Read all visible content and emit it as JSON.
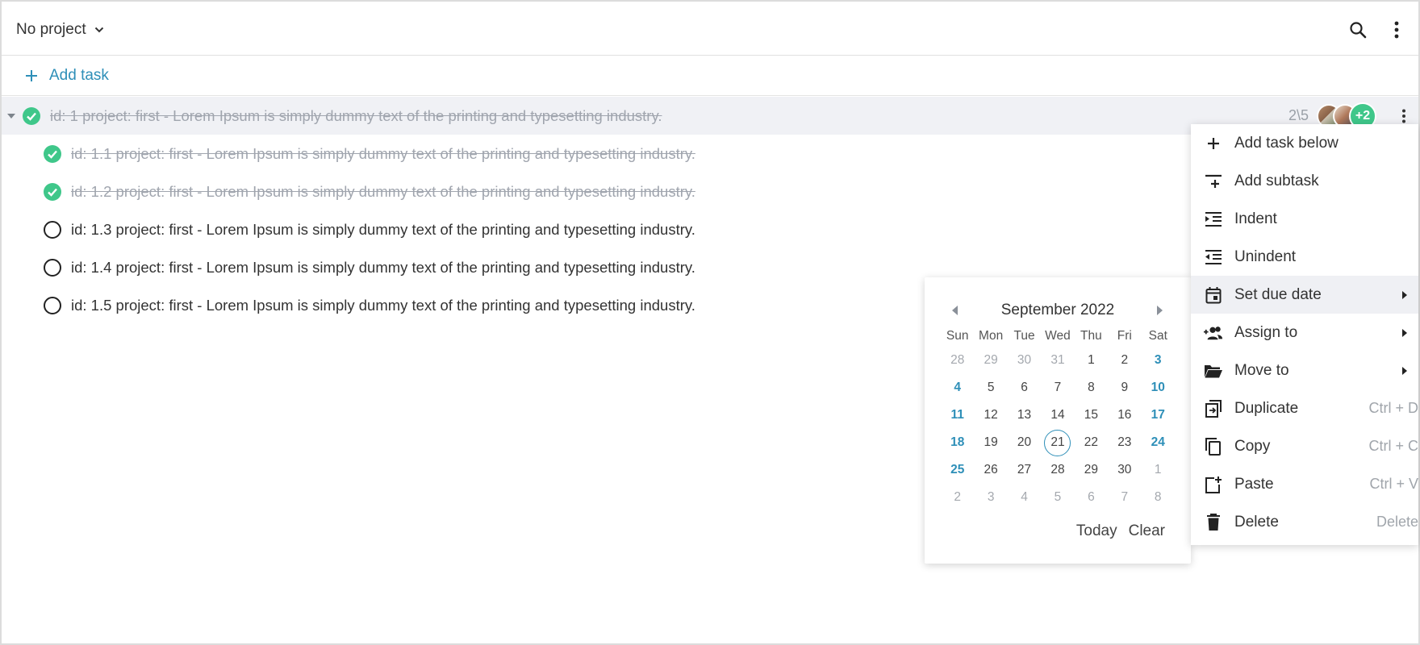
{
  "header": {
    "project_label": "No project"
  },
  "add_task": {
    "label": "Add task"
  },
  "tasks": [
    {
      "text": "id: 1 project: first - Lorem Ipsum is simply dummy text of the printing and typesetting industry.",
      "done": true
    },
    {
      "text": "id: 1.1 project: first - Lorem Ipsum is simply dummy text of the printing and typesetting industry.",
      "done": true
    },
    {
      "text": "id: 1.2 project: first - Lorem Ipsum is simply dummy text of the printing and typesetting industry.",
      "done": true
    },
    {
      "text": "id: 1.3 project: first - Lorem Ipsum is simply dummy text of the printing and typesetting industry.",
      "done": false
    },
    {
      "text": "id: 1.4 project: first - Lorem Ipsum is simply dummy text of the printing and typesetting industry.",
      "done": false
    },
    {
      "text": "id: 1.5 project: first - Lorem Ipsum is simply dummy text of the printing and typesetting industry.",
      "done": false
    }
  ],
  "parent_meta": {
    "subtask_count": "2\\5",
    "extra_assignees": "+2"
  },
  "calendar": {
    "title": "September 2022",
    "days_of_week": [
      "Sun",
      "Mon",
      "Tue",
      "Wed",
      "Thu",
      "Fri",
      "Sat"
    ],
    "weeks": [
      [
        "28",
        "29",
        "30",
        "31",
        "1",
        "2",
        "3"
      ],
      [
        "4",
        "5",
        "6",
        "7",
        "8",
        "9",
        "10"
      ],
      [
        "11",
        "12",
        "13",
        "14",
        "15",
        "16",
        "17"
      ],
      [
        "18",
        "19",
        "20",
        "21",
        "22",
        "23",
        "24"
      ],
      [
        "25",
        "26",
        "27",
        "28",
        "29",
        "30",
        "1"
      ],
      [
        "2",
        "3",
        "4",
        "5",
        "6",
        "7",
        "8"
      ]
    ],
    "selected_day": "21",
    "today_label": "Today",
    "clear_label": "Clear"
  },
  "menu": {
    "items": [
      {
        "label": "Add task below",
        "shortcut": "",
        "icon": "plus-icon"
      },
      {
        "label": "Add subtask",
        "shortcut": "",
        "icon": "add-subtask-icon"
      },
      {
        "label": "Indent",
        "shortcut": "",
        "icon": "indent-icon"
      },
      {
        "label": "Unindent",
        "shortcut": "",
        "icon": "unindent-icon"
      },
      {
        "label": "Set due date",
        "shortcut": "",
        "icon": "calendar-icon"
      },
      {
        "label": "Assign to",
        "shortcut": "",
        "icon": "assign-user-icon"
      },
      {
        "label": "Move to",
        "shortcut": "",
        "icon": "folder-icon"
      },
      {
        "label": "Duplicate",
        "shortcut": "Ctrl + D",
        "icon": "duplicate-icon"
      },
      {
        "label": "Copy",
        "shortcut": "Ctrl + C",
        "icon": "copy-icon"
      },
      {
        "label": "Paste",
        "shortcut": "Ctrl + V",
        "icon": "paste-icon"
      },
      {
        "label": "Delete",
        "shortcut": "Delete",
        "icon": "trash-icon"
      }
    ]
  },
  "colors": {
    "accent": "#2e8fb8",
    "done_green": "#3fc78a"
  }
}
